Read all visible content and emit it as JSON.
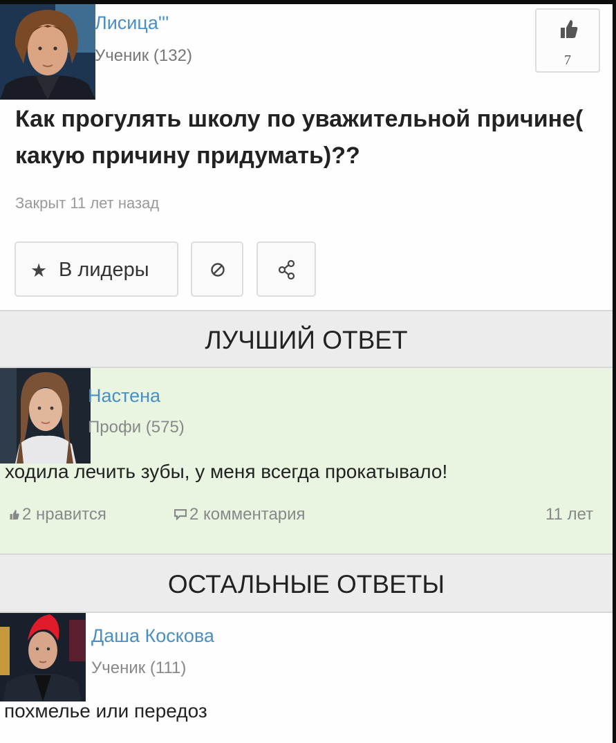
{
  "question": {
    "author": "Лисица'''",
    "rank": "Ученик (132)",
    "likes": "7",
    "title": "Как прогулять школу по уважительной причине( какую причину придумать)??",
    "status": "Закрыт 11 лет назад",
    "buttons": {
      "leaders_icon": "star-icon",
      "leaders_label": "В лидеры",
      "block_icon": "block-icon",
      "share_icon": "share-icon"
    }
  },
  "best_answer": {
    "section_title": "ЛУЧШИЙ ОТВЕТ",
    "author": "Настена",
    "rank": "Профи (575)",
    "text": "ходила лечить зубы, у меня всегда прокатывало!",
    "likes": "2 нравится",
    "comments": "2 комментария",
    "time": "11 лет"
  },
  "other_answers": {
    "section_title": "ОСТАЛЬНЫЕ ОТВЕТЫ",
    "items": [
      {
        "author": "Даша Коскова",
        "rank": "Ученик (111)",
        "text": "похмелье или передоз"
      }
    ]
  },
  "colors": {
    "link_blue": "#4a8fc4",
    "best_answer_bg": "#e9f4e1",
    "section_header_bg": "#ececec"
  }
}
